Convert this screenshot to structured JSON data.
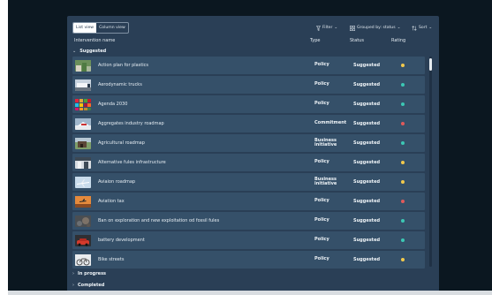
{
  "toolbar": {
    "list_view": "List view",
    "column_view": "Column view",
    "filter": "Filter",
    "grouped_by": "Grouped by: status",
    "sort": "Sort"
  },
  "columns": {
    "name": "Intervention name",
    "type": "Type",
    "status": "Status",
    "rating": "Rating"
  },
  "groups": {
    "suggested": "Suggested",
    "in_progress": "In progress",
    "completed": "Completed"
  },
  "rating_colors": {
    "yellow": "#f2c94c",
    "teal": "#3cc7b4",
    "red": "#e05a5a"
  },
  "items": [
    {
      "name": "Action plan for plastics",
      "type": "Policy",
      "status": "Suggested",
      "rating": "yellow",
      "thumb": "plastics"
    },
    {
      "name": "Aerodynamic trucks",
      "type": "Policy",
      "status": "Suggested",
      "rating": "teal",
      "thumb": "trucks"
    },
    {
      "name": "Agenda 2030",
      "type": "Policy",
      "status": "Suggested",
      "rating": "teal",
      "thumb": "sdg-grid"
    },
    {
      "name": "Aggregates industry roadmap",
      "type": "Commitment",
      "status": "Suggested",
      "rating": "red",
      "thumb": "aggregates"
    },
    {
      "name": "Agricultural roadmap",
      "type": "Business initiative",
      "status": "Suggested",
      "rating": "teal",
      "thumb": "agriculture"
    },
    {
      "name": "Alternative fules infrastructure",
      "type": "Policy",
      "status": "Suggested",
      "rating": "yellow",
      "thumb": "fuel-station"
    },
    {
      "name": "Aviaion roadmap",
      "type": "Business initiative",
      "status": "Suggested",
      "rating": "yellow",
      "thumb": "airplane"
    },
    {
      "name": "Aviation tax",
      "type": "Policy",
      "status": "Suggested",
      "rating": "red",
      "thumb": "airplane-sunset"
    },
    {
      "name": "Ban on exploration and new exploitation od fossil fules",
      "type": "Policy",
      "status": "Suggested",
      "rating": "teal",
      "thumb": "rocks"
    },
    {
      "name": "battery development",
      "type": "Policy",
      "status": "Suggested",
      "rating": "teal",
      "thumb": "battery-car"
    },
    {
      "name": "Bike streets",
      "type": "Policy",
      "status": "Suggested",
      "rating": "yellow",
      "thumb": "bicycle"
    }
  ]
}
